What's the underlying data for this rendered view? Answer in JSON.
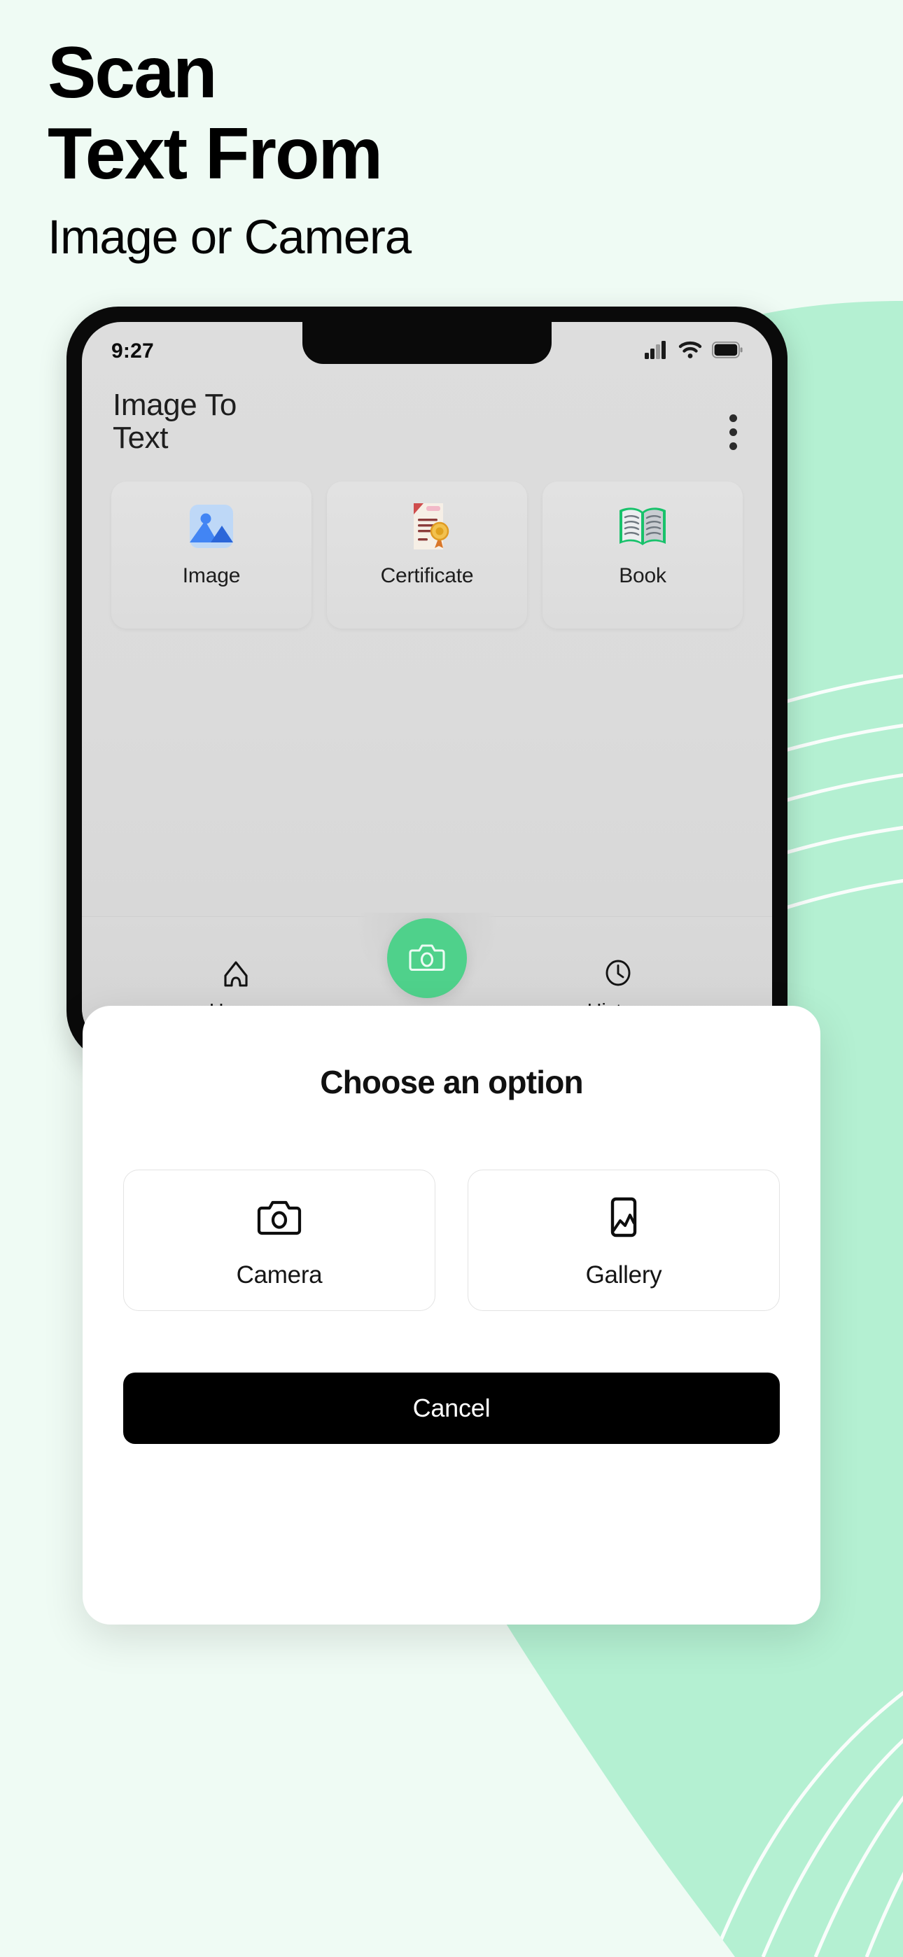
{
  "background": {
    "page_color": "#effbf4",
    "blob_color": "#b4f0d2",
    "line_color": "#ffffff"
  },
  "headline": {
    "line1": "Scan",
    "line2": "Text From",
    "line3": "Image or Camera"
  },
  "phone": {
    "status_bar": {
      "time": "9:27",
      "icons": [
        "signal-icon",
        "wifi-icon",
        "battery-icon"
      ]
    },
    "app_header": {
      "title": "Image To\nText",
      "overflow_menu_icon": "three-dots-vertical-icon"
    },
    "categories": [
      {
        "label": "Image",
        "icon": "photo-mountain-icon"
      },
      {
        "label": "Certificate",
        "icon": "certificate-seal-icon"
      },
      {
        "label": "Book",
        "icon": "open-book-icon"
      }
    ],
    "bottom_nav": {
      "items": [
        {
          "label": "Home",
          "icon": "home-icon"
        },
        {
          "label": "History",
          "icon": "clock-icon"
        }
      ],
      "fab": {
        "icon": "camera-icon",
        "color": "#4fd18b"
      }
    }
  },
  "modal": {
    "title": "Choose an option",
    "options": [
      {
        "label": "Camera",
        "icon": "camera-outline-icon"
      },
      {
        "label": "Gallery",
        "icon": "image-outline-icon"
      }
    ],
    "cancel_label": "Cancel"
  }
}
